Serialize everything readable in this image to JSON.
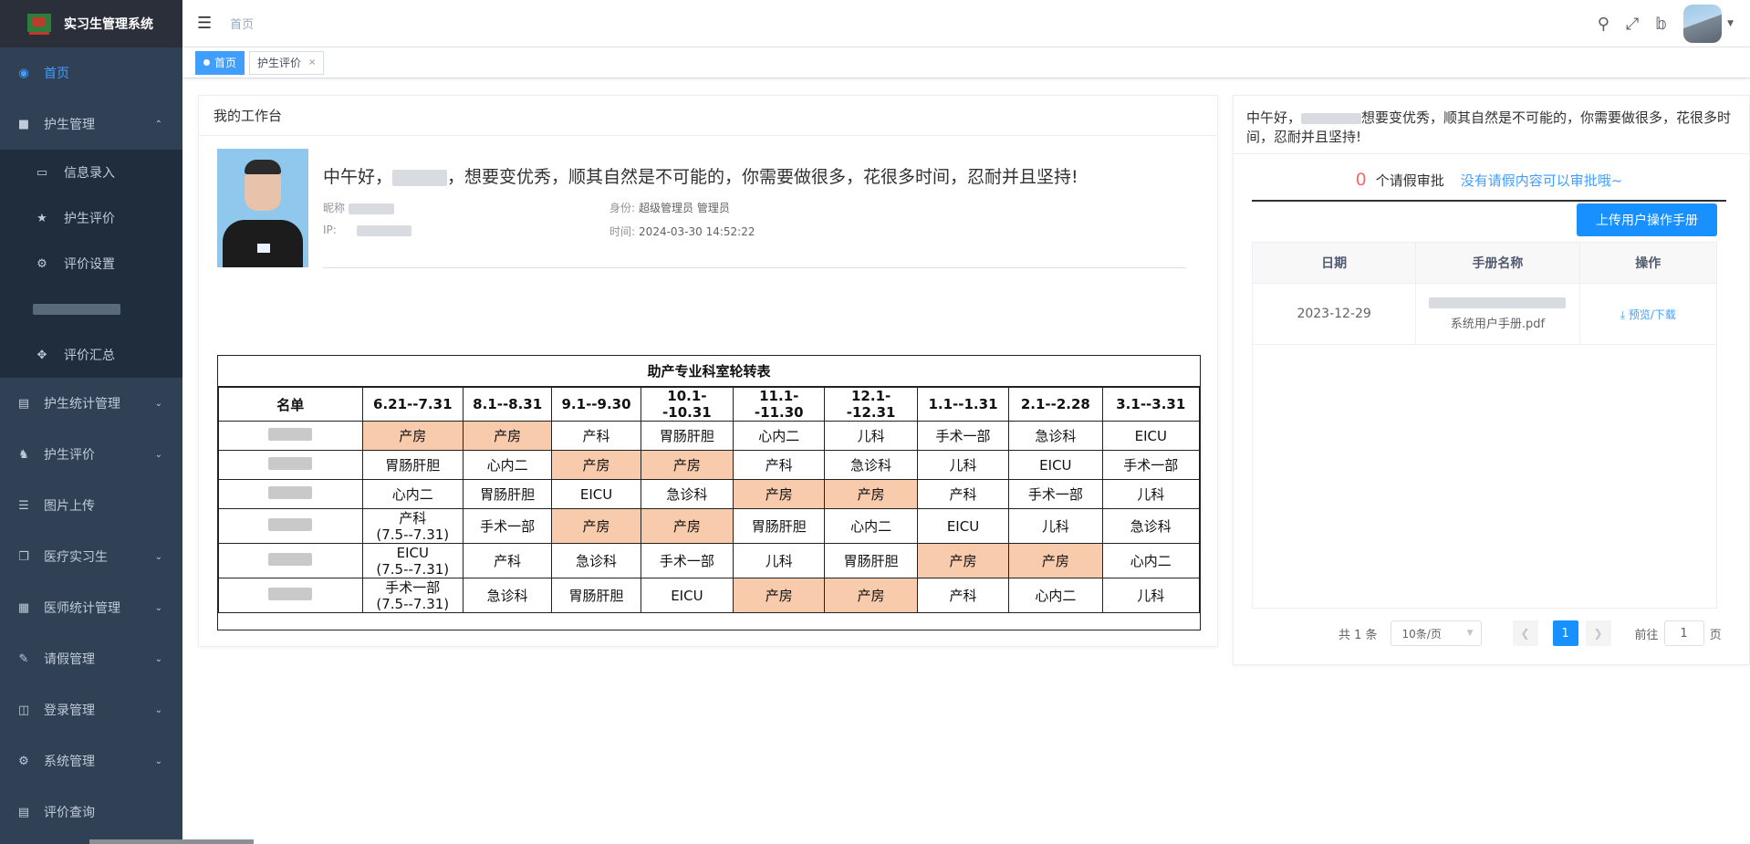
{
  "app": {
    "title": "实习生管理系统"
  },
  "sidebar": {
    "items": [
      {
        "label": "首页",
        "icon": "dashboard-icon"
      },
      {
        "label": "护生管理",
        "icon": "nurse-icon"
      },
      {
        "label": "护生统计管理",
        "icon": "chart-icon"
      },
      {
        "label": "护生评价",
        "icon": "user-icon"
      },
      {
        "label": "图片上传",
        "icon": "list-icon"
      },
      {
        "label": "医疗实习生",
        "icon": "copy-icon"
      },
      {
        "label": "医师统计管理",
        "icon": "document-icon"
      },
      {
        "label": "请假管理",
        "icon": "edit-icon"
      },
      {
        "label": "登录管理",
        "icon": "log-icon"
      },
      {
        "label": "系统管理",
        "icon": "gear-icon"
      },
      {
        "label": "评价查询",
        "icon": "search-doc-icon"
      }
    ],
    "submenu": [
      {
        "label": "信息录入",
        "icon": "form-icon"
      },
      {
        "label": "护生评价",
        "icon": "star-icon"
      },
      {
        "label": "评价设置",
        "icon": "gear-icon"
      },
      {
        "label": "",
        "icon": ""
      },
      {
        "label": "评价汇总",
        "icon": "move-icon"
      }
    ]
  },
  "navbar": {
    "breadcrumb": "首页"
  },
  "tags": [
    {
      "label": "首页",
      "active": true
    },
    {
      "label": "护生评价",
      "close": "×"
    }
  ],
  "workbench": {
    "title": "我的工作台",
    "greeting_prefix": "中午好，",
    "greeting_suffix": "，想要变优秀，顺其自然是不可能的，你需要做很多，花很多时间，忍耐并且坚持!",
    "nickname_label": "昵称",
    "ip_label": "IP:",
    "identity_label": "身份:",
    "identity_value": "超级管理员 管理员",
    "time_label": "时间:",
    "time_value": "2024-03-30 14:52:22"
  },
  "rotation": {
    "title": "助产专业科室轮转表",
    "headers": [
      "名单",
      "6.21--7.31",
      "8.1--8.31",
      "9.1--9.30",
      "10.1--10.31",
      "11.1--11.30",
      "12.1--12.31",
      "1.1--1.31",
      "2.1--2.28",
      "3.1--3.31"
    ],
    "rows": [
      {
        "cells": [
          "产房",
          "产房",
          "产科",
          "胃肠肝胆",
          "心内二",
          "儿科",
          "手术一部",
          "急诊科",
          "EICU"
        ],
        "hl": [
          0,
          1
        ]
      },
      {
        "cells": [
          "胃肠肝胆",
          "心内二",
          "产房",
          "产房",
          "产科",
          "急诊科",
          "儿科",
          "EICU",
          "手术一部"
        ],
        "hl": [
          2,
          3
        ]
      },
      {
        "cells": [
          "心内二",
          "胃肠肝胆",
          "EICU",
          "急诊科",
          "产房",
          "产房",
          "产科",
          "手术一部",
          "儿科"
        ],
        "hl": [
          4,
          5
        ]
      },
      {
        "cells": [
          "产科\n(7.5--7.31)",
          "手术一部",
          "产房",
          "产房",
          "胃肠肝胆",
          "心内二",
          "EICU",
          "儿科",
          "急诊科"
        ],
        "hl": [
          2,
          3
        ]
      },
      {
        "cells": [
          "EICU\n(7.5--7.31)",
          "产科",
          "急诊科",
          "手术一部",
          "儿科",
          "胃肠肝胆",
          "产房",
          "产房",
          "心内二"
        ],
        "hl": [
          6,
          7
        ]
      },
      {
        "cells": [
          "手术一部\n(7.5--7.31)",
          "急诊科",
          "胃肠肝胆",
          "EICU",
          "产房",
          "产房",
          "产科",
          "心内二",
          "儿科"
        ],
        "hl": [
          4,
          5
        ]
      }
    ]
  },
  "right_panel": {
    "greeting_prefix": "中午好，",
    "greeting_suffix": "想要变优秀，顺其自然是不可能的，你需要做很多，花很多时间，忍耐并且坚持!",
    "leave_count": "0",
    "leave_text": "个请假审批",
    "leave_link": "没有请假内容可以审批哦~",
    "upload_button": "上传用户操作手册",
    "table_headers": [
      "日期",
      "手册名称",
      "操作"
    ],
    "table_rows": [
      {
        "date": "2023-12-29",
        "name": "系统用户手册.pdf",
        "action": "预览/下载"
      }
    ],
    "pager": {
      "total": "共 1 条",
      "page_size": "10条/页",
      "current": "1",
      "goto_label": "前往",
      "goto_value": "1",
      "page_suffix": "页"
    }
  }
}
